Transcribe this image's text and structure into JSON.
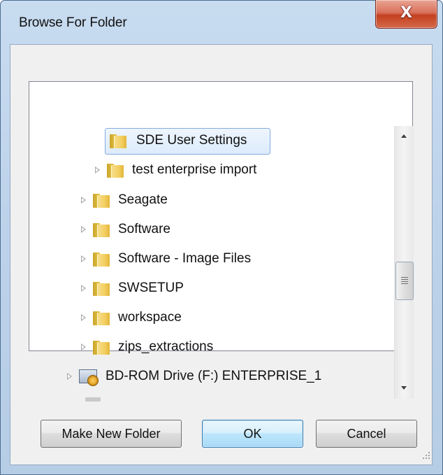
{
  "window": {
    "title": "Browse For Folder",
    "close_glyph": "X"
  },
  "tree": {
    "items": [
      {
        "label": "SDE User Settings",
        "icon": "folder-icon",
        "expandable": false,
        "selected": true
      },
      {
        "label": "test enterprise import",
        "icon": "folder-icon",
        "expandable": true,
        "selected": false
      },
      {
        "label": "Seagate",
        "icon": "folder-icon",
        "expandable": true,
        "selected": false
      },
      {
        "label": "Software",
        "icon": "folder-icon",
        "expandable": true,
        "selected": false
      },
      {
        "label": "Software - Image Files",
        "icon": "folder-icon",
        "expandable": true,
        "selected": false
      },
      {
        "label": "SWSETUP",
        "icon": "folder-icon",
        "expandable": true,
        "selected": false
      },
      {
        "label": "workspace",
        "icon": "folder-icon",
        "expandable": true,
        "selected": false
      },
      {
        "label": "zips_extractions",
        "icon": "folder-icon",
        "expandable": true,
        "selected": false
      },
      {
        "label": "BD-ROM Drive (F:) ENTERPRISE_1",
        "icon": "bd-rom-drive-icon",
        "expandable": true,
        "selected": false
      }
    ]
  },
  "buttons": {
    "make_new_folder": "Make New Folder",
    "ok": "OK",
    "cancel": "Cancel"
  },
  "colors": {
    "frame": "#bcd2ea",
    "close_button": "#c4401f",
    "selection_border": "#84acdd",
    "ok_button": "#bee6fd"
  }
}
